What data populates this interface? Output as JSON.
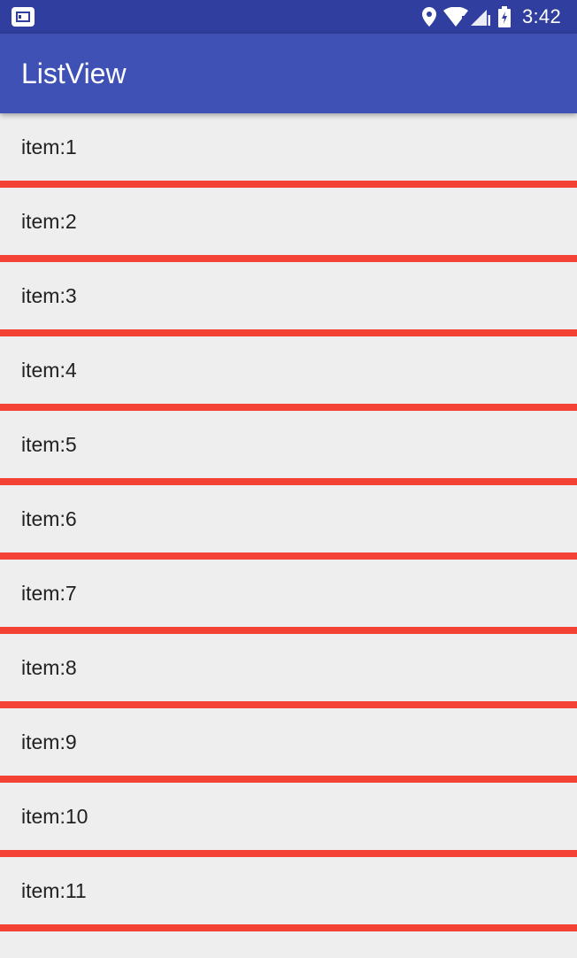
{
  "status_bar": {
    "left_icon": "notification-card-icon",
    "icons": [
      "location-pin-icon",
      "wifi-icon",
      "signal-icon",
      "battery-icon"
    ],
    "time": "3:42"
  },
  "app_bar": {
    "title": "ListView"
  },
  "list": {
    "items": [
      {
        "label": "item:1"
      },
      {
        "label": "item:2"
      },
      {
        "label": "item:3"
      },
      {
        "label": "item:4"
      },
      {
        "label": "item:5"
      },
      {
        "label": "item:6"
      },
      {
        "label": "item:7"
      },
      {
        "label": "item:8"
      },
      {
        "label": "item:9"
      },
      {
        "label": "item:10"
      },
      {
        "label": "item:11"
      },
      {
        "label": ""
      }
    ]
  },
  "colors": {
    "status_bar": "#303f9f",
    "app_bar": "#3f51b5",
    "divider": "#f44336",
    "background": "#eeeeee",
    "text": "#212121"
  }
}
